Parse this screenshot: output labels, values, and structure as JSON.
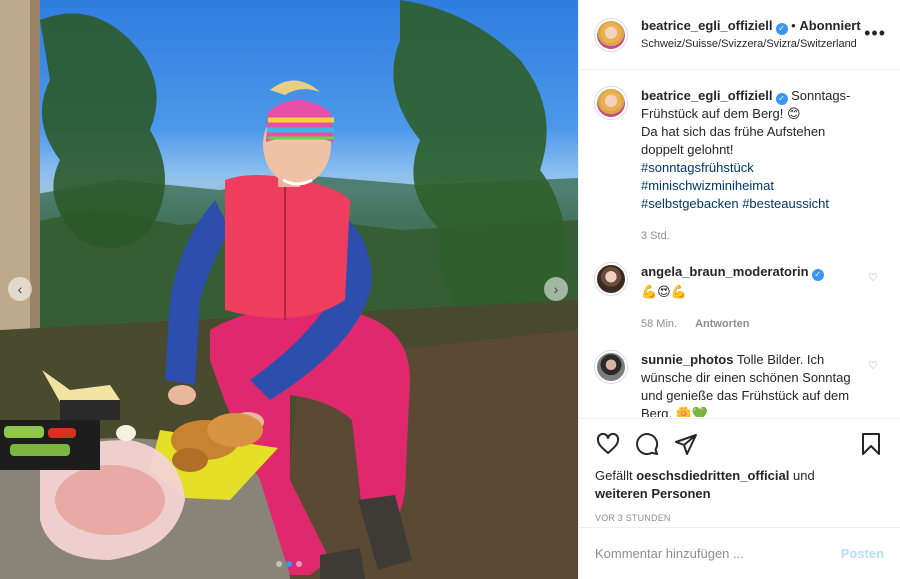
{
  "post": {
    "image_alt": "Woman in pink outfit and rainbow headband smiling on a mountain top with breakfast",
    "prev_label": "‹",
    "next_label": "›",
    "carousel_count": 3,
    "carousel_active": 1
  },
  "header": {
    "username": "beatrice_egli_offiziell",
    "verified_mark": "✓",
    "separator": "•",
    "follow_label": "Abonniert",
    "location": "Schweiz/Suisse/Svizzera/Svizra/Switzerland",
    "more_label": "•••"
  },
  "caption": {
    "username": "beatrice_egli_offiziell",
    "text_line1": "Sonntags-Frühstück auf dem Berg! 😊",
    "text_line2": "Da hat sich das frühe Aufstehen doppelt gelohnt!",
    "hashtags": [
      "#sonntagsfrühstück",
      "#minischwizminiheimat",
      "#selbstgebacken",
      "#besteaussicht"
    ],
    "time": "3 Std."
  },
  "comments": [
    {
      "username": "angela_braun_moderatorin",
      "verified": true,
      "text": "💪😍💪",
      "time": "58 Min.",
      "reply_label": "Antworten"
    },
    {
      "username": "sunnie_photos",
      "verified": false,
      "text": "Tolle Bilder. Ich wünsche dir einen schönen Sonntag und genieße das Frühstück auf dem Berg. 🌼💚"
    }
  ],
  "actions": {
    "like_icon": "heart-outline-icon",
    "comment_icon": "comment-icon",
    "share_icon": "share-icon",
    "save_icon": "bookmark-icon"
  },
  "likes": {
    "prefix": "Gefällt",
    "user": "oeschsdiedritten_official",
    "middle": "und",
    "suffix": "weiteren Personen"
  },
  "timestamp": "VOR 3 STUNDEN",
  "add_comment": {
    "placeholder": "Kommentar hinzufügen ...",
    "post_label": "Posten"
  },
  "colors": {
    "accent": "#3897f0",
    "post_button_disabled": "#b2dffc",
    "hashtag": "#00376b",
    "muted": "#8e8e8e"
  }
}
